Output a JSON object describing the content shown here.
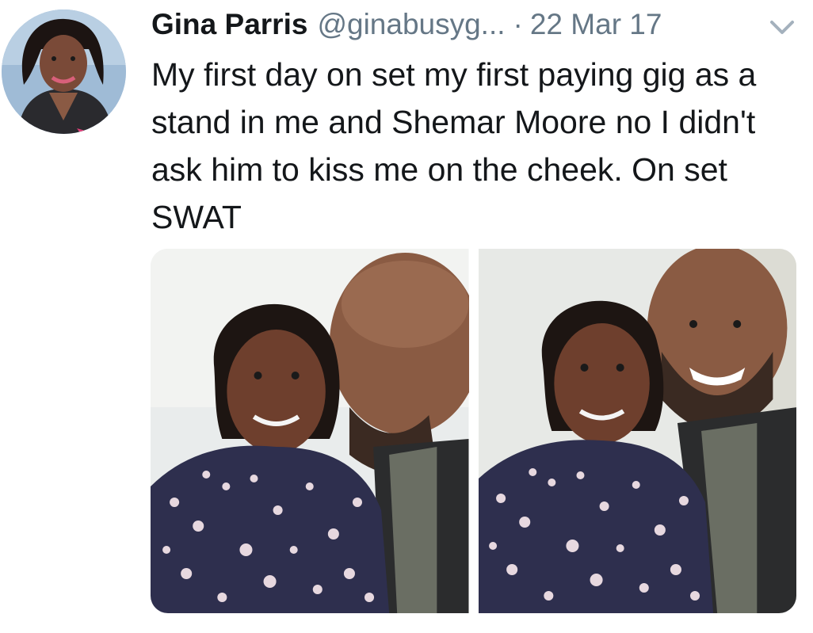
{
  "tweet": {
    "author_name": "Gina Parris",
    "author_handle": "@ginabusyg...",
    "separator": "·",
    "date": "22 Mar 17",
    "text": "My first day on set my first paying gig as a stand in me and Shemar Moore no I didn't ask him to kiss me on the cheek. On set SWAT",
    "menu_icon": "chevron-down-icon",
    "avatar_icon": "profile-photo",
    "photos": [
      {
        "icon": "photo-kiss-on-cheek"
      },
      {
        "icon": "photo-smiling-selfie"
      }
    ]
  },
  "colors": {
    "text_primary": "#14171a",
    "text_secondary": "#657786",
    "background": "#ffffff"
  }
}
